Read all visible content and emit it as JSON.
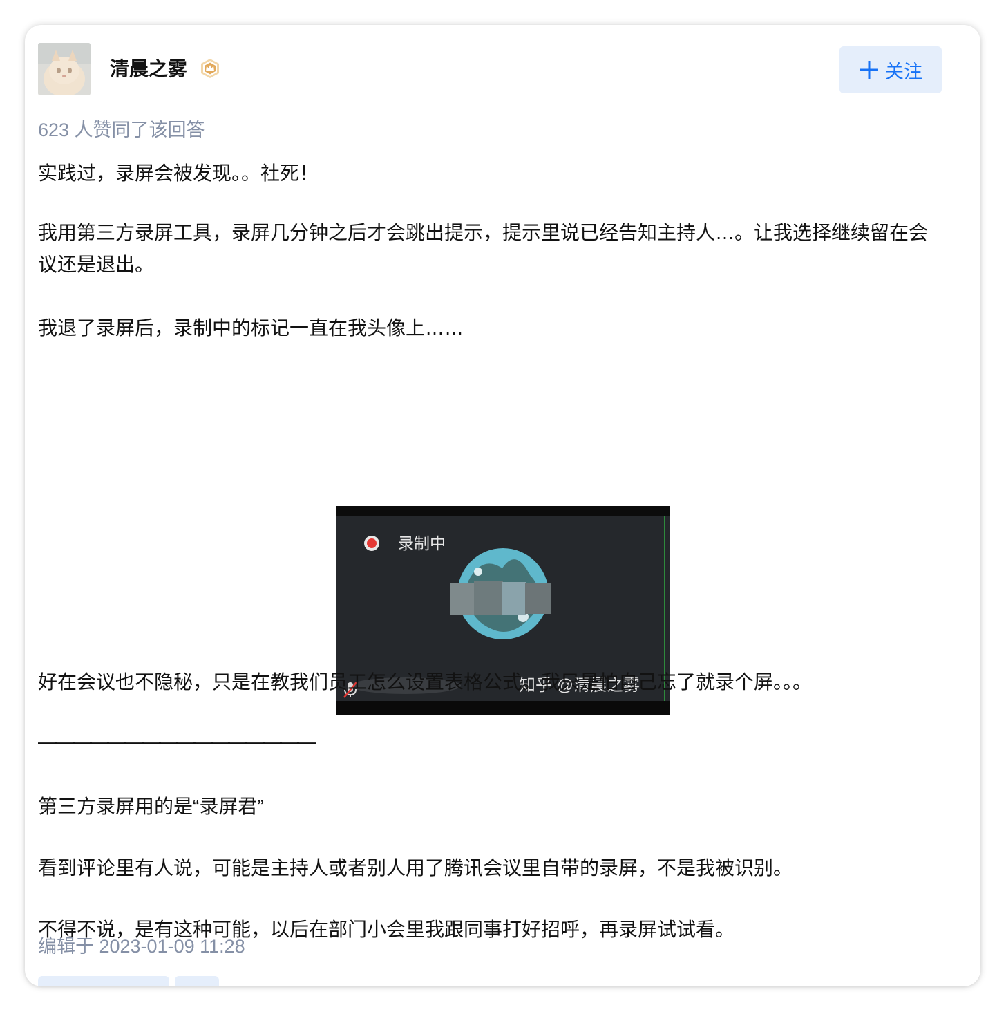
{
  "author": {
    "name": "清晨之雾",
    "avatar_icon": "cat-avatar",
    "badge_icon": "crown-badge-icon"
  },
  "follow_button": {
    "label": "关注",
    "icon": "plus-icon",
    "color": "#1772f6"
  },
  "upvotes_text": "623 人赞同了该回答",
  "paragraphs": [
    "实践过，录屏会被发现。。社死！",
    "我用第三方录屏工具，录屏几分钟之后才会跳出提示，提示里说已经告知主持人…。让我选择继续留在会议还是退出。",
    "我退了录屏后，录制中的标记一直在我头像上……",
    "好在会议也不隐秘，只是在教我们员工怎么设置表格公式。我只是怕自己忘了就录个屏。。。",
    "————————————————",
    "第三方录屏用的是“录屏君”",
    "看到评论里有人说，可能是主持人或者别人用了腾讯会议里自带的录屏，不是我被识别。",
    "不得不说，是有这种可能，以后在部门小会里我跟同事打好招呼，再录屏试试看。"
  ],
  "figure": {
    "recording_label": "录制中",
    "watermark": "知乎 @清晨之雾",
    "mic_icon": "mic-muted-icon"
  },
  "edit_time": "编辑于 2023-01-09 11:28",
  "colors": {
    "muted_text": "#8590a6",
    "button_bg": "#e5eefb"
  }
}
